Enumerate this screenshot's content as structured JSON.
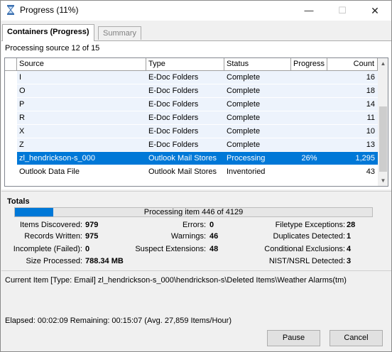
{
  "window": {
    "title": "Progress (11%)",
    "icon": "hourglass-icon",
    "controls": {
      "minimize": "—",
      "maximize": "☐",
      "close": "✕"
    }
  },
  "tabs": [
    {
      "label": "Containers (Progress)",
      "active": true
    },
    {
      "label": "Summary",
      "active": false
    }
  ],
  "processing_source": "Processing source  12 of 15",
  "table": {
    "columns": [
      "Source",
      "Type",
      "Status",
      "Progress",
      "Count"
    ],
    "rows": [
      {
        "source": "I",
        "type": "E-Doc Folders",
        "status": "Complete",
        "progress": "",
        "count": "16"
      },
      {
        "source": "O",
        "type": "E-Doc Folders",
        "status": "Complete",
        "progress": "",
        "count": "18"
      },
      {
        "source": "P",
        "type": "E-Doc Folders",
        "status": "Complete",
        "progress": "",
        "count": "14"
      },
      {
        "source": "R",
        "type": "E-Doc Folders",
        "status": "Complete",
        "progress": "",
        "count": "11"
      },
      {
        "source": "X",
        "type": "E-Doc Folders",
        "status": "Complete",
        "progress": "",
        "count": "10"
      },
      {
        "source": "Z",
        "type": "E-Doc Folders",
        "status": "Complete",
        "progress": "",
        "count": "13"
      },
      {
        "source": "zl_hendrickson-s_000",
        "type": "Outlook Mail Stores",
        "status": "Processing",
        "progress": "26%",
        "count": "1,295",
        "selected": true
      },
      {
        "source": "Outlook Data File",
        "type": "Outlook Mail Stores",
        "status": "Inventoried",
        "progress": "",
        "count": "43"
      }
    ]
  },
  "totals": {
    "title": "Totals",
    "progress_fraction": 0.108,
    "progress_text": "Processing item 446 of 4129",
    "stats": {
      "items_discovered": {
        "label": "Items Discovered:",
        "value": "979"
      },
      "records_written": {
        "label": "Records Written:",
        "value": "975"
      },
      "incomplete": {
        "label": "Incomplete (Failed):",
        "value": "0"
      },
      "size_processed": {
        "label": "Size Processed:",
        "value": "788.34 MB"
      },
      "errors": {
        "label": "Errors:",
        "value": "0"
      },
      "warnings": {
        "label": "Warnings:",
        "value": "46"
      },
      "suspect_extensions": {
        "label": "Suspect Extensions:",
        "value": "48"
      },
      "filetype_exceptions": {
        "label": "Filetype Exceptions:",
        "value": "28"
      },
      "duplicates_detected": {
        "label": "Duplicates Detected:",
        "value": "1"
      },
      "conditional_exclusions": {
        "label": "Conditional Exclusions:",
        "value": "4"
      },
      "nist_detected": {
        "label": "NIST/NSRL Detected:",
        "value": "3"
      }
    }
  },
  "current_item": "Current Item [Type: Email] zl_hendrickson-s_000\\hendrickson-s\\Deleted Items\\Weather Alarms(tm)",
  "footer": {
    "elapsed": "Elapsed: 00:02:09   Remaining: 00:15:07   (Avg. 27,859 Items/Hour)",
    "pause_label": "Pause",
    "cancel_label": "Cancel"
  },
  "colors": {
    "selection": "#0078d7",
    "row_tint": "#edf3fc",
    "progress_fill": "#0078d7"
  }
}
